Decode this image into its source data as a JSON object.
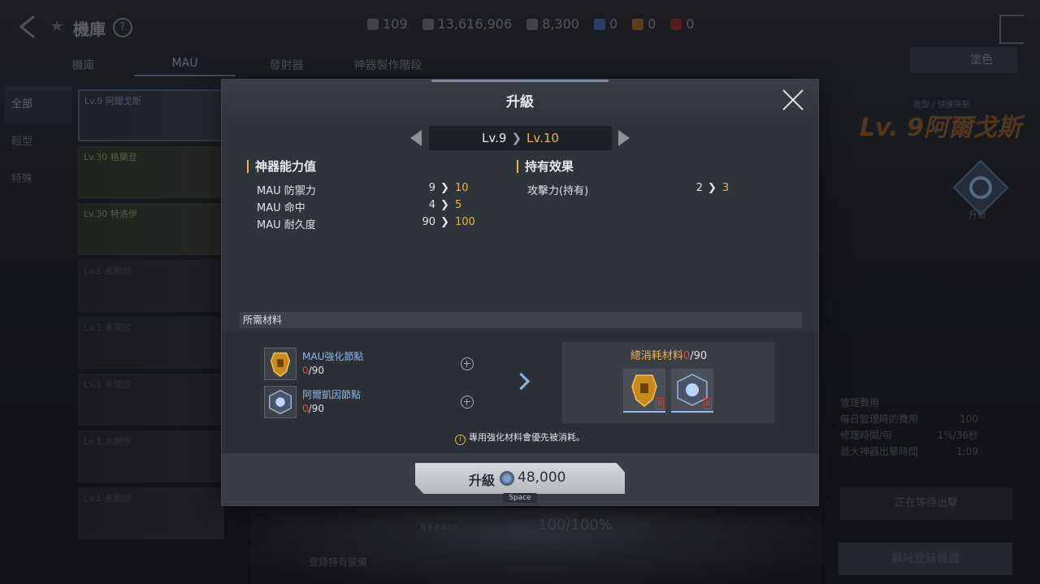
{
  "background": {
    "title": "機庫",
    "currencies": [
      {
        "icon": "fuel-icon",
        "value": "109",
        "color": "#8c9197"
      },
      {
        "icon": "credit-icon",
        "value": "13,616,906",
        "color": "#8c9197"
      },
      {
        "icon": "pen-icon",
        "value": "8,300",
        "color": "#8c9197"
      },
      {
        "icon": "blue-token-icon",
        "value": "0",
        "color": "#5f86c4"
      },
      {
        "icon": "orange-token-icon",
        "value": "0",
        "color": "#c8892e"
      },
      {
        "icon": "red-token-icon",
        "value": "0",
        "color": "#c03a3a"
      }
    ],
    "tabs": [
      "機庫",
      "MAU",
      "發射器",
      "神器製作階段"
    ],
    "right_button": "塗色",
    "side_filters": [
      "全部",
      "輕型",
      "特殊"
    ],
    "mech_cards": [
      {
        "label": "Lv.9 阿爾戈斯"
      },
      {
        "label": "Lv.30 格蘭登"
      },
      {
        "label": "Lv.30 特洛伊"
      },
      {
        "label": "Lv.1 未開放"
      },
      {
        "label": "Lv.1 未開放"
      },
      {
        "label": "Lv.1 未開放"
      },
      {
        "label": "Lv.1 未開放"
      },
      {
        "label": "Lv.1 未開放"
      },
      {
        "label": "Lv.1 未開放"
      }
    ],
    "mech_level": "Lv. 9",
    "mech_name": "阿爾戈斯",
    "mech_subtitle": "輕型 / 快速突擊",
    "upgrade_label": "升級",
    "stats_title": "管理費用",
    "stats": [
      {
        "label": "每日管理時的費用",
        "value": "100"
      },
      {
        "label": "修理時間/每",
        "value": "1%/36秒"
      },
      {
        "label": "最大神器出擊時間",
        "value": "1:09"
      }
    ],
    "waiting_button": "正在等待出擊",
    "unequip_button": "解除登錄機體",
    "hp_text": "100/100%",
    "repair_label": "REPAIR",
    "bottom_label": "登錄特有裝備"
  },
  "dialog": {
    "title": "升級",
    "level_from": "Lv.9",
    "level_to": "Lv.10",
    "stats_header": "神器能力值",
    "effects_header": "持有效果",
    "stats": [
      {
        "name": "MAU 防禦力",
        "old": "9",
        "new": "10"
      },
      {
        "name": "MAU 命中",
        "old": "4",
        "new": "5"
      },
      {
        "name": "MAU 耐久度",
        "old": "90",
        "new": "100"
      }
    ],
    "effects": [
      {
        "name": "攻擊力(持有)",
        "old": "2",
        "new": "3"
      }
    ],
    "materials_header": "所需材料",
    "materials": [
      {
        "name": "MAU強化節點",
        "have": "0",
        "need": "/90",
        "icon": "gold-node-icon"
      },
      {
        "name": "阿爾凱因節點",
        "have": "0",
        "need": "/90",
        "icon": "blue-node-icon"
      }
    ],
    "total_label": "總消耗材料",
    "total_have": "0",
    "total_need": "/90",
    "total_slots": [
      {
        "icon": "gold-node-icon",
        "badge": "0"
      },
      {
        "icon": "blue-node-icon",
        "badge": "0"
      }
    ],
    "notice": "專用強化材料會優先被消耗。",
    "upgrade_button": "升級",
    "upgrade_cost": "48,000",
    "hotkey": "Space",
    "arrow_glyph": "❯"
  },
  "colors": {
    "accent": "#e7b64f",
    "material_name": "#8fb6e6",
    "insufficient": "#e24a3c"
  }
}
